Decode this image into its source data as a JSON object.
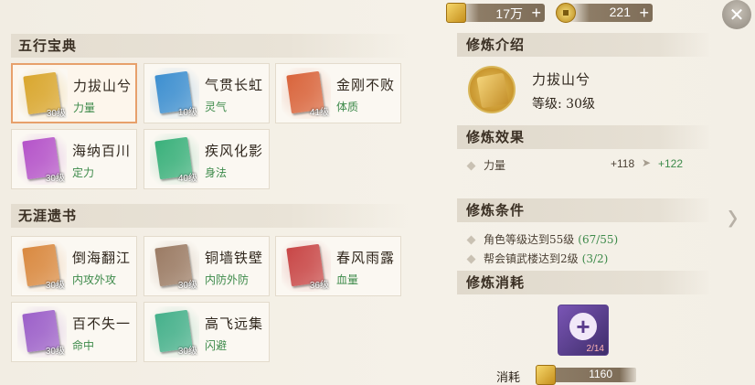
{
  "topbar": {
    "gold_value": "17万",
    "coin_value": "221",
    "plus_label": "+"
  },
  "close_label": "✕",
  "left": {
    "section1": {
      "title": "五行宝典",
      "books": [
        {
          "name": "力拔山兮",
          "attr": "力量",
          "level": "30级",
          "color": "#d9a62c",
          "selected": true
        },
        {
          "name": "气贯长虹",
          "attr": "灵气",
          "level": "10级",
          "color": "#3b8ed0",
          "selected": false
        },
        {
          "name": "金刚不败",
          "attr": "体质",
          "level": "41级",
          "color": "#d9633a",
          "selected": false
        },
        {
          "name": "海纳百川",
          "attr": "定力",
          "level": "30级",
          "color": "#b452c9",
          "selected": false
        },
        {
          "name": "疾风化影",
          "attr": "身法",
          "level": "40级",
          "color": "#38b07a",
          "selected": false
        }
      ]
    },
    "section2": {
      "title": "无涯遗书",
      "books": [
        {
          "name": "倒海翻江",
          "attr": "内攻外攻",
          "level": "30级",
          "color": "#d9883e"
        },
        {
          "name": "铜墙铁壁",
          "attr": "内防外防",
          "level": "30级",
          "color": "#9a7a63"
        },
        {
          "name": "春风雨露",
          "attr": "血量",
          "level": "36级",
          "color": "#c84545"
        },
        {
          "name": "百不失一",
          "attr": "命中",
          "level": "30级",
          "color": "#9b5ec9"
        },
        {
          "name": "高飞远集",
          "attr": "闪避",
          "level": "30级",
          "color": "#43b08a"
        }
      ]
    }
  },
  "right": {
    "intro_title": "修炼介绍",
    "book_name": "力拔山兮",
    "level_text": "等级: 30级",
    "effect_title": "修炼效果",
    "effect": {
      "stat": "力量",
      "from": "+118",
      "to": "+122"
    },
    "cond_title": "修炼条件",
    "conditions": [
      {
        "text": "角色等级达到55级",
        "progress": "(67/55)"
      },
      {
        "text": "帮会镇武楼达到2级",
        "progress": "(3/2)"
      }
    ],
    "cost_title": "修炼消耗",
    "cost_item_count": "2/14",
    "cost_label": "消耗",
    "cost_value": "1160"
  }
}
